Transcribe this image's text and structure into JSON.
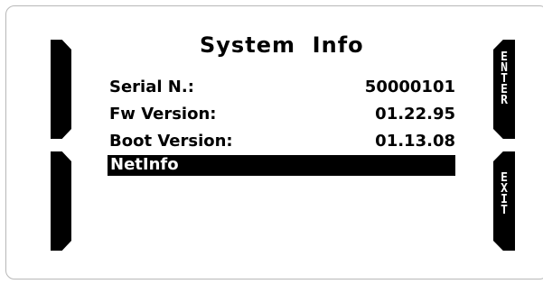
{
  "screen": {
    "title": "System  Info",
    "rows": [
      {
        "key": "Serial N.:",
        "value": "50000101"
      },
      {
        "key": "Fw Version:",
        "value": "01.22.95"
      },
      {
        "key": "Boot Version:",
        "value": "01.13.08"
      }
    ],
    "menu": {
      "selected_label": "NetInfo"
    }
  },
  "softkeys": {
    "right_top": [
      "E",
      "N",
      "T",
      "E",
      "R"
    ],
    "right_bottom": [
      "E",
      "X",
      "I",
      "T"
    ]
  },
  "colors": {
    "background": "#ffffff",
    "foreground": "#000000",
    "highlight": "#000000"
  }
}
